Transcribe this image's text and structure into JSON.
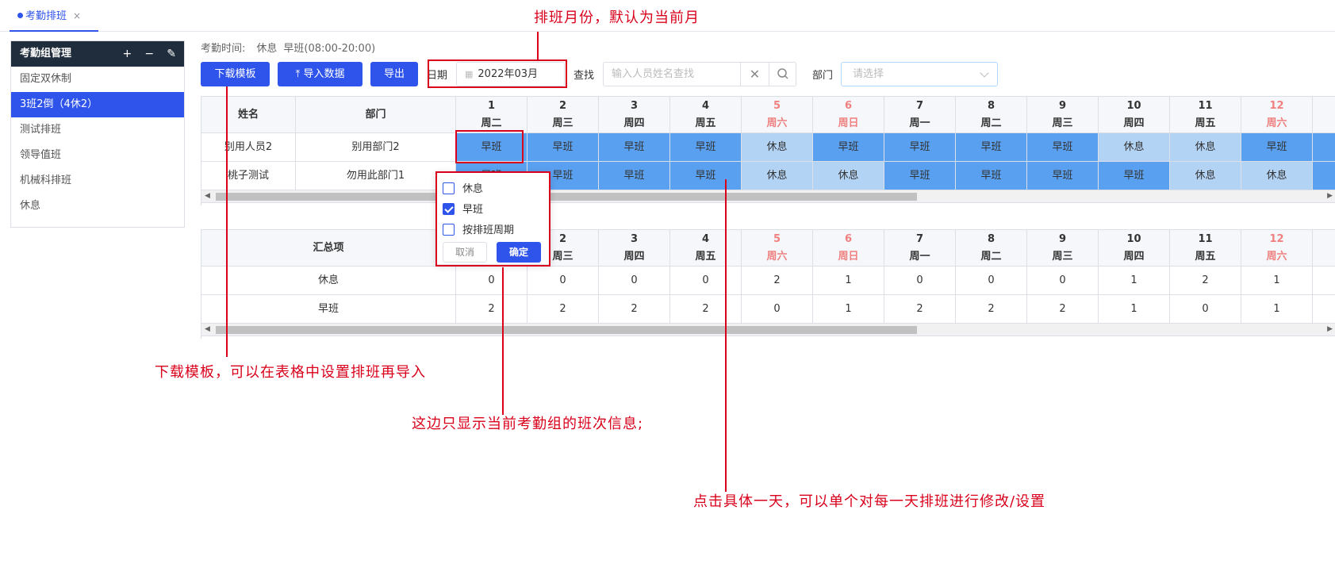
{
  "tab": {
    "label": "考勤排班",
    "close": "×"
  },
  "sidebar": {
    "title": "考勤组管理",
    "tools": {
      "add": "+",
      "remove": "−",
      "edit": "✎"
    },
    "items": [
      {
        "label": "固定双休制",
        "active": false
      },
      {
        "label": "3班2倒（4休2）",
        "active": true
      },
      {
        "label": "测试排班",
        "active": false
      },
      {
        "label": "领导值班",
        "active": false
      },
      {
        "label": "机械科排班",
        "active": false
      },
      {
        "label": "休息",
        "active": false
      }
    ]
  },
  "info": {
    "label": "考勤时间:",
    "rest": "休息",
    "shift": "早班(08:00-20:00)"
  },
  "toolbar": {
    "download": "下载模板",
    "import": "导入数据",
    "export": "导出",
    "date_label": "日期",
    "date_value": "2022年03月",
    "search_label": "查找",
    "search_placeholder": "输入人员姓名查找",
    "dept_label": "部门",
    "dept_placeholder": "请选择"
  },
  "days": [
    {
      "num": "1",
      "wk": "周二",
      "weekend": false
    },
    {
      "num": "2",
      "wk": "周三",
      "weekend": false
    },
    {
      "num": "3",
      "wk": "周四",
      "weekend": false
    },
    {
      "num": "4",
      "wk": "周五",
      "weekend": false
    },
    {
      "num": "5",
      "wk": "周六",
      "weekend": true
    },
    {
      "num": "6",
      "wk": "周日",
      "weekend": true
    },
    {
      "num": "7",
      "wk": "周一",
      "weekend": false
    },
    {
      "num": "8",
      "wk": "周二",
      "weekend": false
    },
    {
      "num": "9",
      "wk": "周三",
      "weekend": false
    },
    {
      "num": "10",
      "wk": "周四",
      "weekend": false
    },
    {
      "num": "11",
      "wk": "周五",
      "weekend": false
    },
    {
      "num": "12",
      "wk": "周六",
      "weekend": true
    }
  ],
  "schedule": {
    "headers": {
      "name": "姓名",
      "dept": "部门"
    },
    "rows": [
      {
        "name": "别用人员2",
        "dept": "别用部门2",
        "shifts": [
          "早班",
          "早班",
          "早班",
          "早班",
          "休息",
          "早班",
          "早班",
          "早班",
          "早班",
          "休息",
          "休息",
          "早班"
        ]
      },
      {
        "name": "桃子测试",
        "dept": "勿用此部门1",
        "shifts": [
          "早班",
          "早班",
          "早班",
          "早班",
          "休息",
          "休息",
          "早班",
          "早班",
          "早班",
          "早班",
          "休息",
          "休息"
        ]
      }
    ]
  },
  "summary": {
    "header": "汇总项",
    "rows": [
      {
        "label": "休息",
        "values": [
          "0",
          "0",
          "0",
          "0",
          "2",
          "1",
          "0",
          "0",
          "0",
          "1",
          "2",
          "1"
        ]
      },
      {
        "label": "早班",
        "values": [
          "2",
          "2",
          "2",
          "2",
          "0",
          "1",
          "2",
          "2",
          "2",
          "1",
          "0",
          "1"
        ]
      }
    ]
  },
  "popup": {
    "options": [
      {
        "label": "休息",
        "checked": false
      },
      {
        "label": "早班",
        "checked": true
      },
      {
        "label": "按排班周期",
        "checked": false
      }
    ],
    "cancel": "取消",
    "ok": "确定"
  },
  "annotations": {
    "month": "排班月份，默认为当前月",
    "template": "下载模板，可以在表格中设置排班再导入",
    "group": "这边只显示当前考勤组的班次信息;",
    "day": "点击具体一天，可以单个对每一天排班进行修改/设置"
  },
  "colors": {
    "primary": "#2f54eb",
    "shift_work": "#5aa0f0",
    "shift_rest": "#b3d3f5",
    "annotation": "#d9001b",
    "weekend": "#f08080"
  }
}
